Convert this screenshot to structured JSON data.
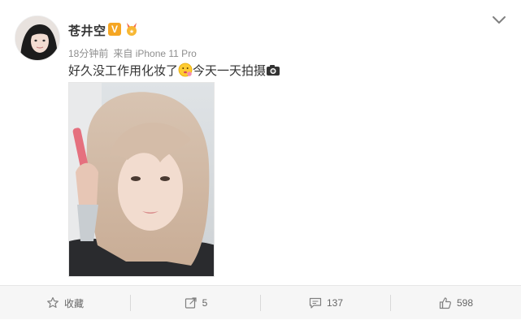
{
  "post": {
    "username": "苍井空",
    "verified_badge": "V",
    "time": "18分钟前",
    "source": "来自 iPhone 11 Pro",
    "text_part1": "好久没工作用化妆了",
    "text_part2": "今天一天拍摄",
    "emoji_1": "thinking-face-icon",
    "emoji_2": "camera-icon"
  },
  "actions": {
    "favorite_label": "收藏",
    "repost_count": "5",
    "comment_count": "137",
    "like_count": "598"
  },
  "colors": {
    "badge": "#f5a623",
    "action_bar_bg": "#f6f6f6",
    "meta_text": "#8e8e8e"
  }
}
